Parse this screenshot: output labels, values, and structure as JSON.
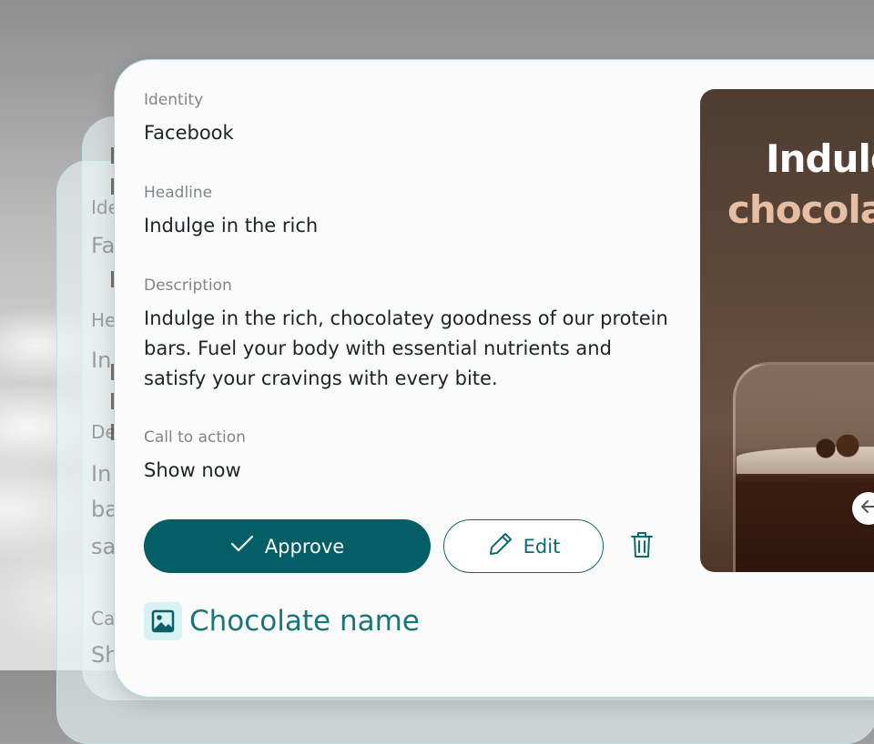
{
  "card": {
    "fields": [
      {
        "label": "Identity",
        "value": "Facebook"
      },
      {
        "label": "Headline",
        "value": "Indulge in the rich"
      },
      {
        "label": "Description",
        "value": "Indulge in the rich, chocolatey goodness of our protein bars. Fuel your body with essential nutrients and satisfy your cravings with every bite."
      },
      {
        "label": "Call to action",
        "value": "Show now"
      }
    ],
    "actions": {
      "approve_label": "Approve",
      "edit_label": "Edit"
    },
    "image_name": "Chocolate name",
    "preview": {
      "line1": "Indulg",
      "line2": "chocola"
    }
  },
  "ghost_cards": {
    "back_labels": [
      "Ide",
      "Fa",
      "He",
      "In",
      "De",
      "In",
      "ba",
      "sa",
      "Ca",
      "Sh"
    ]
  },
  "colors": {
    "accent": "#045e66",
    "accent_text": "#18767b",
    "card_border": "#a9dede"
  }
}
